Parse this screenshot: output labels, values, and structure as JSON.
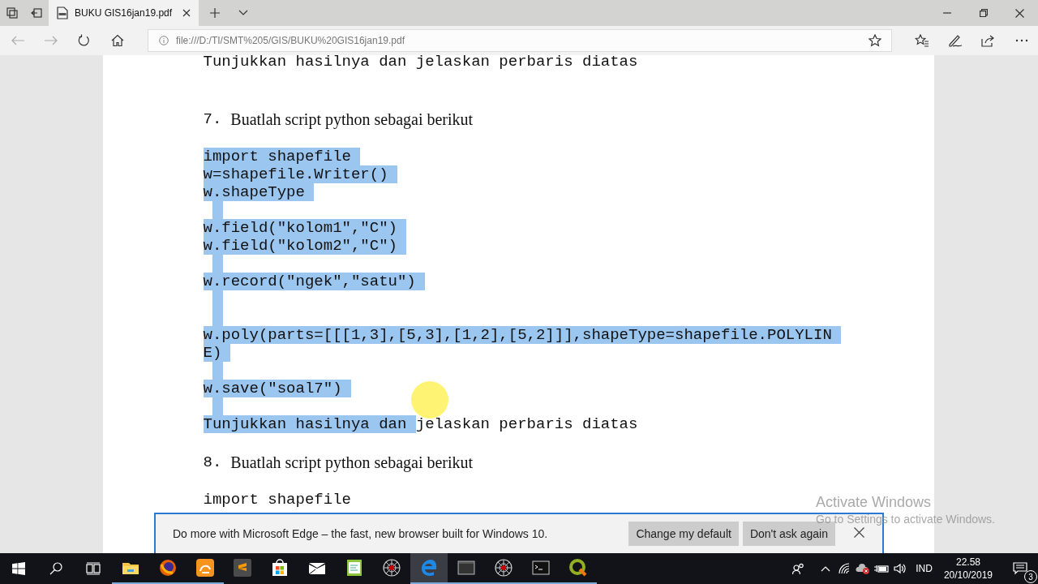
{
  "browser": {
    "tab": {
      "title": "BUKU GIS16jan19.pdf",
      "selected": true
    },
    "address": "file:///D:/TI/SMT%205/GIS/BUKU%20GIS16jan19.pdf"
  },
  "document": {
    "blocks": [
      {
        "kind": "prose",
        "segments": [
          {
            "text": "Tunjukkan hasilnya dan jelaskan perbaris diatas",
            "selected": false
          }
        ]
      },
      {
        "kind": "heading",
        "number": "7.",
        "text": "Buatlah script python sebagai berikut"
      },
      {
        "kind": "code",
        "text": "import shapefile",
        "selected": true
      },
      {
        "kind": "code",
        "text": "w=shapefile.Writer()",
        "selected": true
      },
      {
        "kind": "code",
        "text": "w.shapeType",
        "selected": true
      },
      {
        "kind": "blank",
        "selected": true
      },
      {
        "kind": "code",
        "text": "w.field(\"kolom1\",\"C\")",
        "selected": true
      },
      {
        "kind": "code",
        "text": "w.field(\"kolom2\",\"C\")",
        "selected": true
      },
      {
        "kind": "blank",
        "selected": true
      },
      {
        "kind": "code",
        "text": "w.record(\"ngek\",\"satu\")",
        "selected": true
      },
      {
        "kind": "blank",
        "selected": true
      },
      {
        "kind": "blank",
        "selected": true
      },
      {
        "kind": "code",
        "text": "w.poly(parts=[[[1,3],[5,3],[1,2],[5,2]]],shapeType=shapefile.POLYLIN",
        "selected": true
      },
      {
        "kind": "code",
        "text": "E)",
        "selected": true
      },
      {
        "kind": "blank",
        "selected": true
      },
      {
        "kind": "code",
        "text": "w.save(\"soal7\")",
        "selected": true
      },
      {
        "kind": "blank",
        "selected": true
      },
      {
        "kind": "prose",
        "segments": [
          {
            "text": "Tunjukkan hasilnya dan ",
            "selected": true
          },
          {
            "text": "jelaskan perbaris diatas",
            "selected": false
          }
        ]
      },
      {
        "kind": "heading",
        "number": "8.",
        "text": "Buatlah script python sebagai berikut"
      },
      {
        "kind": "code",
        "text": "import shapefile",
        "selected": false
      }
    ]
  },
  "notification": {
    "message": "Do more with Microsoft Edge – the fast, new browser built for Windows 10.",
    "buttons": [
      "Change my default",
      "Don't ask again"
    ]
  },
  "activation": {
    "title": "Activate Windows",
    "subtitle": "Go to Settings to activate Windows."
  },
  "taskbar": {
    "apps": [
      {
        "kind": "explorer",
        "running": true,
        "selected": false
      },
      {
        "kind": "firefox",
        "running": true,
        "selected": false
      },
      {
        "kind": "uc",
        "running": true,
        "selected": false
      },
      {
        "kind": "sublime",
        "running": false,
        "selected": false
      },
      {
        "kind": "store",
        "running": false,
        "selected": false
      },
      {
        "kind": "mail",
        "running": false,
        "selected": false
      },
      {
        "kind": "notepad",
        "running": false,
        "selected": false
      },
      {
        "kind": "spider",
        "running": false,
        "selected": false
      },
      {
        "kind": "edge",
        "running": true,
        "selected": true
      },
      {
        "kind": "window",
        "running": true,
        "selected": false
      },
      {
        "kind": "spider",
        "running": true,
        "selected": false
      },
      {
        "kind": "cmd",
        "running": true,
        "selected": false
      },
      {
        "kind": "qgis",
        "running": true,
        "selected": false
      }
    ],
    "tray": {
      "language": "IND",
      "time": "22.58",
      "date": "20/10/2019",
      "notifications": "3"
    }
  }
}
